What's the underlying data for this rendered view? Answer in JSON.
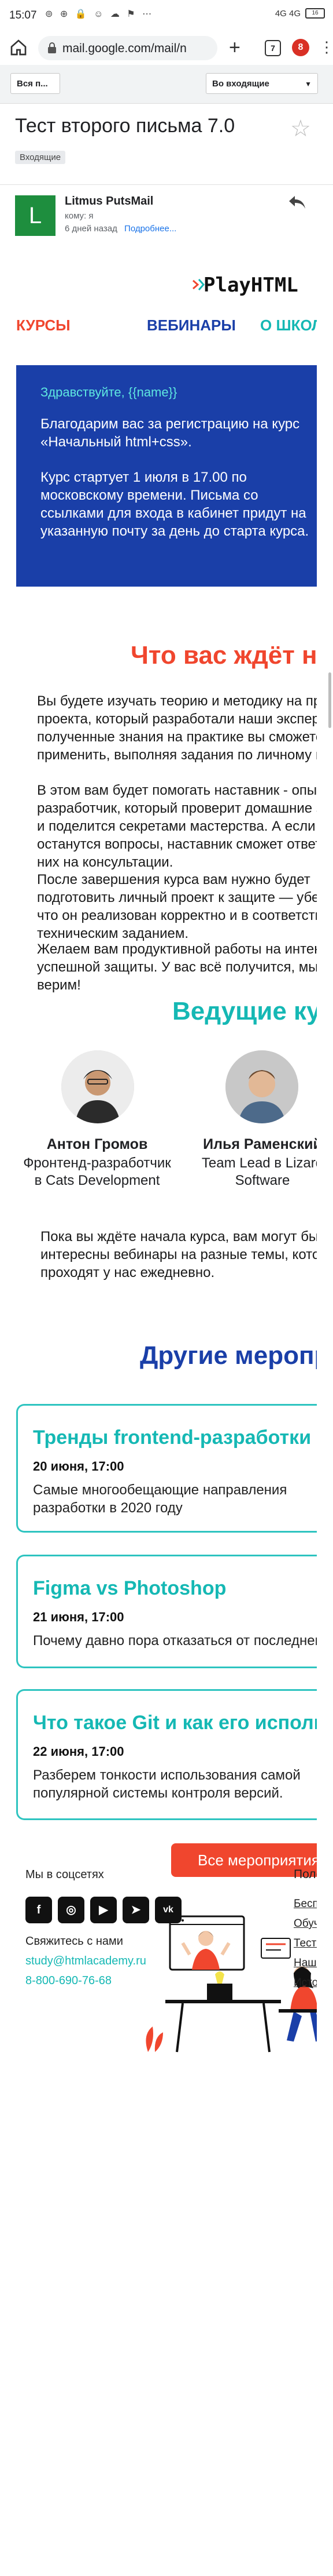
{
  "status_bar": {
    "time": "15:07",
    "icons": "⊚ ⊕ 🔒 ☺ ☁ ⚑ ⋯",
    "network": "4G 4G",
    "battery": "16"
  },
  "browser": {
    "url": "mail.google.com/mail/n",
    "tabs_count": "7",
    "ext_badge": "8"
  },
  "gmail_toolbar": {
    "folder_button": "Вся п...",
    "inbox_button": "Во входящие"
  },
  "message": {
    "subject": "Тест второго письма 7.0",
    "label": "Входящие",
    "sender_initial": "L",
    "sender": "Litmus PutsMail",
    "to": "кому: я",
    "date": "6 дней назад",
    "details_link": "Подробнее..."
  },
  "email": {
    "logo": "PlayHTML",
    "nav": [
      "КУРСЫ",
      "ВЕБИНАРЫ",
      "О ШКОЛЕ"
    ],
    "hero": {
      "greeting": "Здравствуйте, {{name}}",
      "p1": "Благодарим вас за регистрацию на курс «Начальный html+css».",
      "p2": "Курс стартует 1 июля в 17.00 по московскому времени. Письма со ссылками для входа в кабинет придут на указанную почту за день до старта курса."
    },
    "expect": {
      "title": "Что вас ждёт на курсе",
      "p1": "Вы будете изучать теорию и методику на примере проекта, который разработали наши эксперты. А полученные знания на практике вы сможете применить, выполняя задания по личному проекту.",
      "p2": "В этом вам будет помогать наставник - опытный разработчик, который проверит домашние задания и поделится секретами мастерства. А если у вас останутся вопросы, наставник сможет ответить на них на консультации.",
      "p3": "После завершения курса вам нужно будет подготовить личный проект к защите — убедиться, что он реализован корректно и в соответствии с техническим заданием.",
      "p4": "Желаем вам продуктивной работы на интенсиве и успешной защиты. У вас всё получится, мы в вас верим!"
    },
    "teachers": {
      "title": "Ведущие курса",
      "items": [
        {
          "name": "Антон Громов",
          "role": "Фронтенд-разработчик в Cats Development"
        },
        {
          "name": "Илья Раменский",
          "role": "Team Lead в Lizard Software"
        }
      ],
      "note": "Пока вы ждёте начала курса, вам могут быть интересны вебинары на разные темы, которые проходят у нас ежедневно."
    },
    "events": {
      "title": "Другие мероприятия",
      "items": [
        {
          "title": "Тренды frontend-разработки",
          "date": "20 июня, 17:00",
          "desc": "Самые многообещающие направления разработки в 2020 году"
        },
        {
          "title": "Figma vs Photoshop",
          "date": "21 июня, 17:00",
          "desc": "Почему давно пора отказаться от последнего"
        },
        {
          "title": "Что такое Git и как его использовать",
          "date": "22 июня, 17:00",
          "desc": "Разберем тонкости использования самой популярной системы контроля версий."
        }
      ],
      "all_button": "Все мероприятия"
    },
    "footer": {
      "social_title": "Мы в соцсетях",
      "social_icons": [
        "f",
        "◎",
        "▶",
        "➤",
        "vk"
      ],
      "contact_title": "Свяжитесь с нами",
      "email": "study@htmlacademy.ru",
      "phone": "8-800-690-76-68",
      "links_title": "Полезное",
      "links": [
        "Бесплатные",
        "Обучение",
        "Тесты",
        "Наши",
        "История"
      ]
    }
  },
  "colors": {
    "accent_red": "#f0462e",
    "navy": "#1a3fa8",
    "teal": "#15b8b4",
    "hero_bg": "#1a3fa8"
  }
}
